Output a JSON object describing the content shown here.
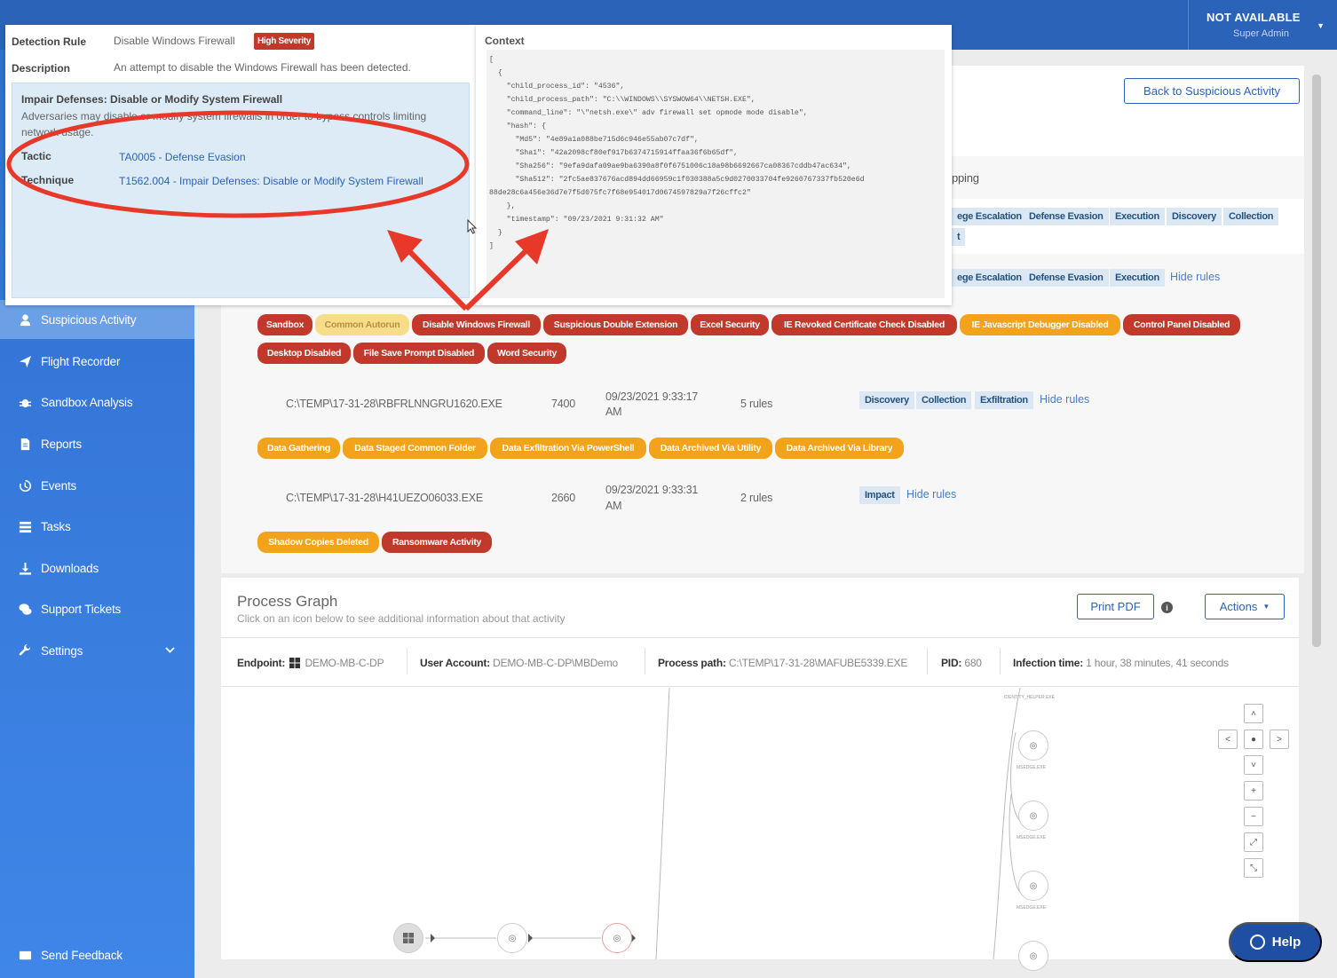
{
  "topbar": {
    "user_name": "NOT AVAILABLE",
    "user_role": "Super Admin"
  },
  "sidebar": {
    "items": [
      {
        "label": "Suspicious Activity",
        "icon": "user-secret-icon",
        "active": true
      },
      {
        "label": "Flight Recorder",
        "icon": "send-icon"
      },
      {
        "label": "Sandbox Analysis",
        "icon": "bug-icon"
      },
      {
        "label": "Reports",
        "icon": "report-icon"
      },
      {
        "label": "Events",
        "icon": "history-icon"
      },
      {
        "label": "Tasks",
        "icon": "list-icon"
      },
      {
        "label": "Downloads",
        "icon": "download-icon"
      },
      {
        "label": "Support Tickets",
        "icon": "chat-icon"
      },
      {
        "label": "Settings",
        "icon": "wrench-icon"
      }
    ],
    "feedback_label": "Send Feedback"
  },
  "main": {
    "back_button": "Back to Suspicious Activity",
    "mapping_fragment": "pping",
    "tactic_rows": [
      {
        "chips": [
          "ege Escalation",
          "Defense Evasion",
          "Execution",
          "Discovery",
          "Collection"
        ],
        "extra": "t"
      },
      {
        "chips": [
          "ege Escalation",
          "Defense Evasion",
          "Execution"
        ],
        "hide_label": "Hide rules"
      }
    ],
    "rule_tags_1": [
      {
        "label": "Sandbox",
        "color": "red"
      },
      {
        "label": "Common Autorun",
        "color": "yellow"
      },
      {
        "label": "Disable Windows Firewall",
        "color": "red"
      },
      {
        "label": "Suspicious Double Extension",
        "color": "red"
      },
      {
        "label": "Excel Security",
        "color": "red"
      },
      {
        "label": "IE Revoked Certificate Check Disabled",
        "color": "red"
      },
      {
        "label": "IE Javascript Debugger Disabled",
        "color": "orange"
      },
      {
        "label": "Control Panel Disabled",
        "color": "red"
      },
      {
        "label": "Desktop Disabled",
        "color": "red"
      },
      {
        "label": "File Save Prompt Disabled",
        "color": "red"
      },
      {
        "label": "Word Security",
        "color": "red"
      }
    ],
    "process_rows": [
      {
        "path": "C:\\TEMP\\17-31-28\\RBFRLNNGRU1620.EXE",
        "pid": "7400",
        "time_line1": "09/23/2021 9:33:17",
        "time_line2": "AM",
        "rules": "5 rules",
        "chips": [
          "Discovery",
          "Collection",
          "Exfiltration"
        ],
        "hide_label": "Hide rules",
        "tags": [
          {
            "label": "Data Gathering",
            "color": "orange"
          },
          {
            "label": "Data Staged Common Folder",
            "color": "orange"
          },
          {
            "label": "Data Exfiltration Via PowerShell",
            "color": "orange"
          },
          {
            "label": "Data Archived Via Utility",
            "color": "orange"
          },
          {
            "label": "Data Archived Via Library",
            "color": "orange"
          }
        ]
      },
      {
        "path": "C:\\TEMP\\17-31-28\\H41UEZO06033.EXE",
        "pid": "2660",
        "time_line1": "09/23/2021 9:33:31",
        "time_line2": "AM",
        "rules": "2 rules",
        "chips": [
          "Impact"
        ],
        "hide_label": "Hide rules",
        "tags": [
          {
            "label": "Shadow Copies Deleted",
            "color": "orange"
          },
          {
            "label": "Ransomware Activity",
            "color": "red"
          }
        ]
      }
    ]
  },
  "graph": {
    "title": "Process Graph",
    "subtitle": "Click on an icon below to see additional information about that activity",
    "print_label": "Print PDF",
    "actions_label": "Actions",
    "meta": {
      "endpoint_label": "Endpoint:",
      "endpoint_value": "DEMO-MB-C-DP",
      "user_label": "User Account:",
      "user_value": "DEMO-MB-C-DP\\MBDemo",
      "path_label": "Process path:",
      "path_value": "C:\\TEMP\\17-31-28\\MAFUBE5339.EXE",
      "pid_label": "PID:",
      "pid_value": "680",
      "infection_label": "Infection time:",
      "infection_value": "1 hour, 38 minutes, 41 seconds"
    },
    "node_labels": [
      "IDENTITY_HELPER.EXE",
      "MSEDGE.EXE",
      "MSEDGE.EXE",
      "MSEDGE.EXE"
    ]
  },
  "popup": {
    "rule_label": "Detection Rule",
    "rule_value": "Disable Windows Firewall",
    "severity": "High Severity",
    "desc_label": "Description",
    "desc_value": "An attempt to disable the Windows Firewall has been detected.",
    "mitre_title": "Impair Defenses: Disable or Modify System Firewall",
    "mitre_desc": "Adversaries may disable or modify system firewalls in order to bypass controls limiting network usage.",
    "tactic_label": "Tactic",
    "tactic_value": "TA0005 - Defense Evasion",
    "technique_label": "Technique",
    "technique_value": "T1562.004 - Impair Defenses: Disable or Modify System Firewall",
    "context_label": "Context",
    "context_json": "[\n  {\n    \"child_process_id\": \"4536\",\n    \"child_process_path\": \"C:\\\\WINDOWS\\\\SYSWOW64\\\\NETSH.EXE\",\n    \"command_line\": \"\\\"netsh.exe\\\" adv firewall set opmode mode disable\",\n    \"hash\": {\n      \"Md5\": \"4e89a1a088be715d6c946e55ab07c7df\",\n      \"Sha1\": \"42a2098cf80ef917b6374715914ffaa36f6b65df\",\n      \"Sha256\": \"9efa9dafa09ae9ba6390a8f0f6751006c18a98b6692667ca08367cddb47ac634\",\n      \"Sha512\": \"2fc5ae837676acd894dd66959c1f030388a5c9d0270033704fe9260767337fb520e6d\n88de28c6a456e36d7e7f5d075fc7f68e954017d0674597829a7f26cffc2\"\n    },\n    \"timestamp\": \"09/23/2021 9:31:32 AM\"\n  }\n]"
  },
  "help": {
    "label": "Help"
  },
  "colors": {
    "brand": "#2a63b8",
    "danger": "#c0392b",
    "warning": "#f3a21b",
    "annotation": "#e8382a"
  }
}
